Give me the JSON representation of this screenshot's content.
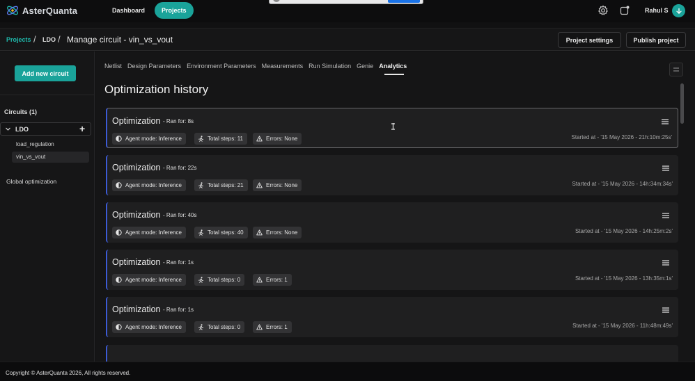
{
  "app": {
    "name": "AsterQuanta"
  },
  "nav": {
    "dashboard": "Dashboard",
    "projects": "Projects"
  },
  "user": {
    "name": "Rahul S"
  },
  "breadcrumb": {
    "projects": "Projects",
    "sep": "/",
    "ldo": "LDO",
    "current": "Manage circuit - vin_vs_vout"
  },
  "actions": {
    "project_settings": "Project settings",
    "publish": "Publish project"
  },
  "sidebar": {
    "add_circuit": "Add new circuit",
    "circuits_title": "Circuits (1)",
    "circuit": {
      "label": "LDO",
      "plus": "+"
    },
    "sub_items": [
      "load_regulation",
      "vin_vs_vout"
    ],
    "global": "Global optimization"
  },
  "tabs": [
    "Netlist",
    "Design Parameters",
    "Environment Parameters",
    "Measurements",
    "Run Simulation",
    "Genie",
    "Analytics"
  ],
  "page_title": "Optimization history",
  "cards": [
    {
      "title": "Optimization",
      "ran": "Ran for: 8s",
      "mode": "Agent mode: Inference",
      "steps": "Total steps: 11",
      "errors": "Errors: None",
      "started": "Started at - '15 May 2026 - 21h:10m:25s'"
    },
    {
      "title": "Optimization",
      "ran": "Ran for: 22s",
      "mode": "Agent mode: Inference",
      "steps": "Total steps: 21",
      "errors": "Errors: None",
      "started": "Started at - '15 May 2026 - 14h:34m:34s'"
    },
    {
      "title": "Optimization",
      "ran": "Ran for: 40s",
      "mode": "Agent mode: Inference",
      "steps": "Total steps: 40",
      "errors": "Errors: None",
      "started": "Started at - '15 May 2026 - 14h:25m:2s'"
    },
    {
      "title": "Optimization",
      "ran": "Ran for: 1s",
      "mode": "Agent mode: Inference",
      "steps": "Total steps: 0",
      "errors": "Errors: 1",
      "started": "Started at - '15 May 2026 - 13h:35m:1s'"
    },
    {
      "title": "Optimization",
      "ran": "Ran for: 1s",
      "mode": "Agent mode: Inference",
      "steps": "Total steps: 0",
      "errors": "Errors: 1",
      "started": "Started at - '15 May 2026 - 11h:48m:49s'"
    }
  ],
  "footer": "Copyright © AsterQuanta 2026, All rights reserved.",
  "colors": {
    "accent": "#1aa39a",
    "card_border": "#3c5bd6"
  }
}
